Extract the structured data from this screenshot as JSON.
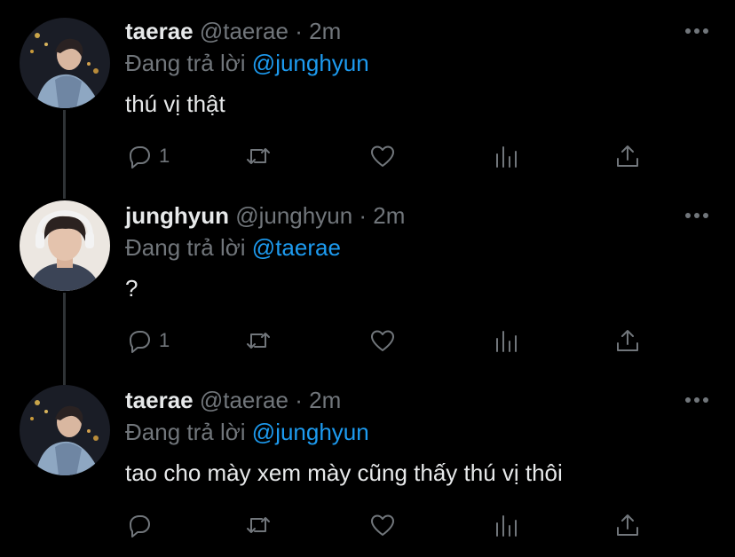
{
  "tweets": [
    {
      "name": "taerae",
      "handle": "@taerae",
      "dot": "·",
      "time": "2m",
      "reply_prefix": "Đang trả lời",
      "reply_to": "@junghyun",
      "text": "thú vị thật",
      "reply_count": "1",
      "avatar_icon": "avatar-taerae"
    },
    {
      "name": "junghyun",
      "handle": "@junghyun",
      "dot": "·",
      "time": "2m",
      "reply_prefix": "Đang trả lời",
      "reply_to": "@taerae",
      "text": "?",
      "reply_count": "1",
      "avatar_icon": "avatar-junghyun"
    },
    {
      "name": "taerae",
      "handle": "@taerae",
      "dot": "·",
      "time": "2m",
      "reply_prefix": "Đang trả lời",
      "reply_to": "@junghyun",
      "text": "tao cho mày xem mày cũng thấy thú vị thôi",
      "reply_count": "",
      "avatar_icon": "avatar-taerae"
    }
  ],
  "colors": {
    "background": "#000000",
    "text": "#e7e9ea",
    "secondary": "#71767b",
    "mention": "#1d9bf0",
    "thread_line": "#2f3336"
  },
  "icons": [
    "reply-icon",
    "retweet-icon",
    "like-icon",
    "analytics-icon",
    "share-icon",
    "more-icon"
  ]
}
